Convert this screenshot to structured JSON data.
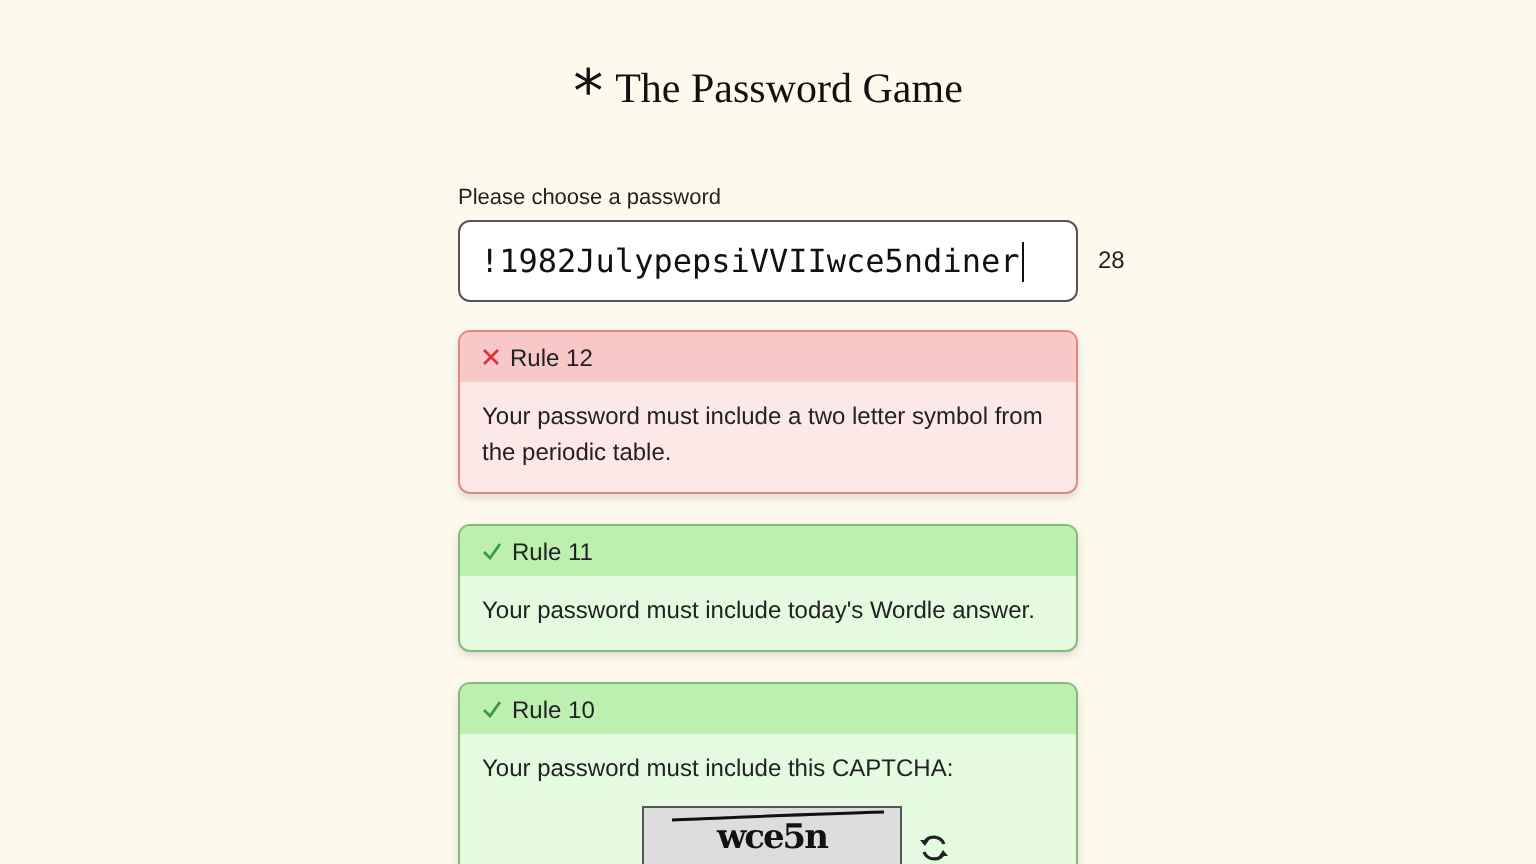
{
  "title": {
    "icon": "*",
    "text": "The Password Game"
  },
  "password": {
    "label": "Please choose a password",
    "value": "!1982JulypepsiVVIIwce5ndiner",
    "length": "28"
  },
  "rules": [
    {
      "title": "Rule 12",
      "passed": false,
      "kind": "text",
      "text": "Your password must include a two letter symbol from the periodic table."
    },
    {
      "title": "Rule 11",
      "passed": true,
      "kind": "text",
      "text": "Your password must include today's Wordle answer."
    },
    {
      "title": "Rule 10",
      "passed": true,
      "kind": "captcha",
      "text": "Your password must include this CAPTCHA:",
      "captcha": "wce5n"
    }
  ]
}
